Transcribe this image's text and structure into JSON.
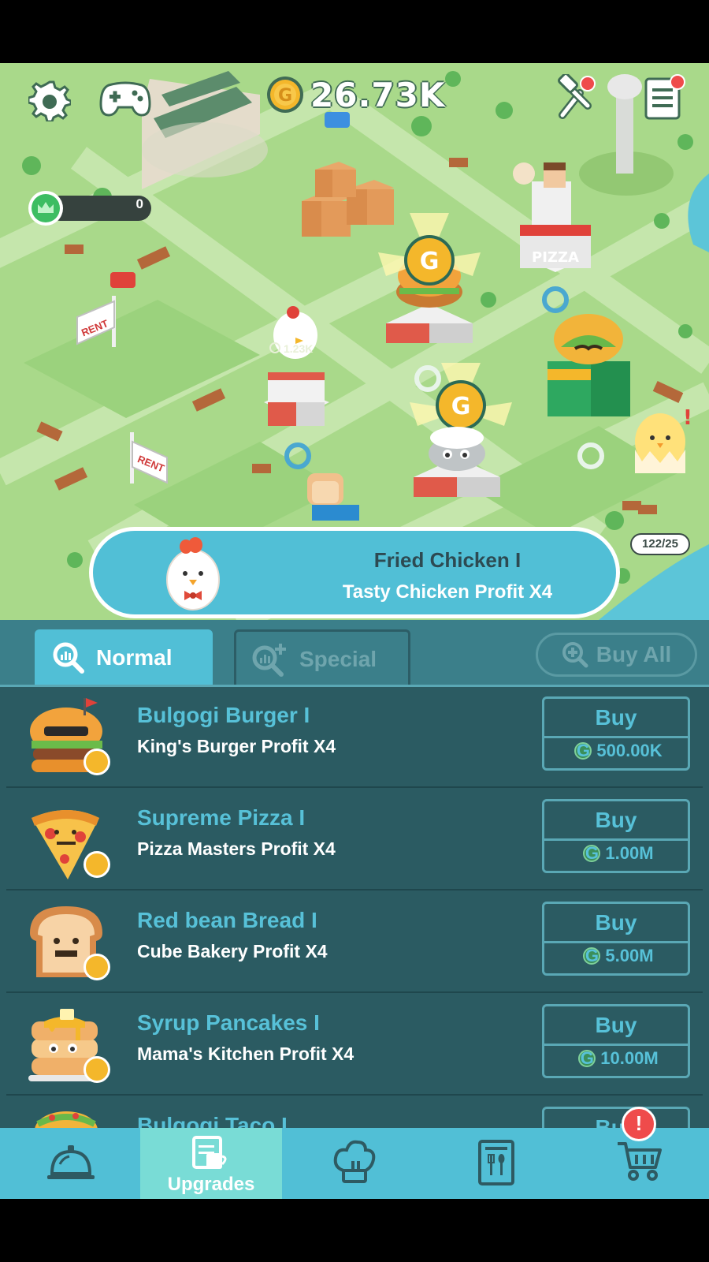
{
  "hud": {
    "coins": "26.73K",
    "crown_level": "0",
    "chick_counter": "122/25",
    "map_coin_label": "1.23K"
  },
  "map": {
    "rent_sign_1": "RENT",
    "rent_sign_2": "RENT",
    "pizza_sign": "PIZZA"
  },
  "banner": {
    "title": "Fried Chicken I",
    "subtitle": "Tasty Chicken Profit X4"
  },
  "tabs": {
    "normal": "Normal",
    "special": "Special",
    "buy_all": "Buy All"
  },
  "upgrades": [
    {
      "name": "Bulgogi Burger I",
      "desc": "King's Burger Profit X4",
      "buy": "Buy",
      "price": "500.00K",
      "icon": "burger-icon"
    },
    {
      "name": "Supreme Pizza I",
      "desc": "Pizza Masters Profit X4",
      "buy": "Buy",
      "price": "1.00M",
      "icon": "pizza-icon"
    },
    {
      "name": "Red bean Bread I",
      "desc": "Cube Bakery Profit X4",
      "buy": "Buy",
      "price": "5.00M",
      "icon": "bread-icon"
    },
    {
      "name": "Syrup Pancakes I",
      "desc": "Mama's Kitchen Profit X4",
      "buy": "Buy",
      "price": "10.00M",
      "icon": "pancake-icon"
    },
    {
      "name": "Bulgogi Taco I",
      "desc": "",
      "buy": "Buy",
      "price": "",
      "icon": "taco-icon"
    }
  ],
  "nav": {
    "upgrades_label": "Upgrades",
    "shop_alert": "!"
  },
  "colors": {
    "accent": "#51bfd6",
    "panel": "#3b7f8a",
    "list": "#2b5b62",
    "map_green": "#a9d98a"
  }
}
